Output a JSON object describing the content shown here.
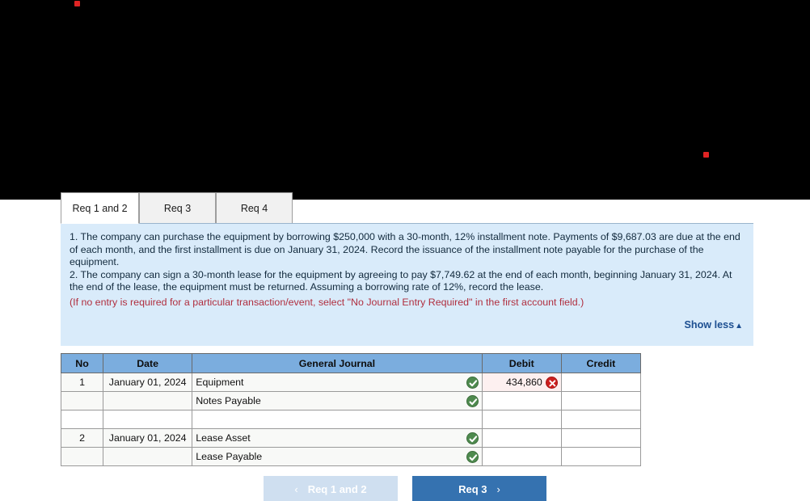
{
  "tabs": [
    {
      "label": "Req 1 and 2",
      "active": true
    },
    {
      "label": "Req 3",
      "active": false
    },
    {
      "label": "Req 4",
      "active": false
    }
  ],
  "instructions": {
    "item1": "1. The company can purchase the equipment by borrowing $250,000 with a 30-month, 12% installment note. Payments of $9,687.03 are due at the end of each month, and the first installment is due on January 31, 2024. Record the issuance of the installment note payable for the purchase of the equipment.",
    "item2": "2. The company can sign a 30-month lease for the equipment by agreeing to pay $7,749.62 at the end of each month, beginning January 31, 2024. At the end of the lease, the equipment must be returned. Assuming a borrowing rate of 12%, record the lease.",
    "note": "(If no entry is required for a particular transaction/event, select \"No Journal Entry Required\" in the first account field.)",
    "show_less_label": "Show less",
    "show_less_caret": "▲"
  },
  "table": {
    "headers": [
      "No",
      "Date",
      "General Journal",
      "Debit",
      "Credit"
    ],
    "rows": [
      {
        "no": "1",
        "date": "January 01, 2024",
        "account": "Equipment",
        "account_status": "check-icon",
        "debit": "434,860",
        "debit_status": "error-icon",
        "credit": "",
        "credit_status": "",
        "filled": true
      },
      {
        "no": "",
        "date": "",
        "account": "Notes Payable",
        "account_status": "check-icon",
        "debit": "",
        "debit_status": "",
        "credit": "",
        "credit_status": "",
        "filled": true
      },
      {
        "no": "",
        "date": "",
        "account": "",
        "account_status": "",
        "debit": "",
        "debit_status": "",
        "credit": "",
        "credit_status": "",
        "filled": false
      },
      {
        "no": "2",
        "date": "January 01, 2024",
        "account": "Lease Asset",
        "account_status": "check-icon",
        "debit": "",
        "debit_status": "",
        "credit": "",
        "credit_status": "",
        "filled": true
      },
      {
        "no": "",
        "date": "",
        "account": "Lease Payable",
        "account_status": "check-icon",
        "debit": "",
        "debit_status": "",
        "credit": "",
        "credit_status": "",
        "filled": true
      }
    ]
  },
  "footer": {
    "prev_label": "Req 1 and 2",
    "prev_chevron": "‹",
    "next_label": "Req 3",
    "next_chevron": "›"
  },
  "colors": {
    "tab_active_bg": "#ffffff",
    "tab_inactive_bg": "#f1f1f1",
    "info_panel_bg": "#d9ebfa",
    "note_text": "#b02f3f",
    "link_blue": "#1d4f91",
    "table_header_blue": "#7badde",
    "status_ok_green": "#4e8a4e",
    "status_error_red": "#cc1f1f",
    "next_button_blue": "#3572b0",
    "prev_button_blue": "#cfdff0",
    "cursor_dot_red": "#e02424"
  }
}
